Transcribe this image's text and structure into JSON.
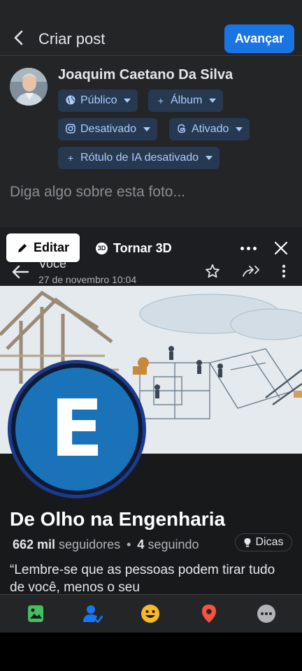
{
  "header": {
    "title": "Criar post",
    "next_label": "Avançar"
  },
  "user": {
    "name": "Joaquim Caetano Da Silva"
  },
  "chips": {
    "audience": "Público",
    "album": "Álbum",
    "instagram": "Desativado",
    "threads": "Ativado",
    "ai_label": "Rótulo de IA desativado"
  },
  "caption": {
    "placeholder": "Diga algo sobre esta foto..."
  },
  "preview": {
    "edit_label": "Editar",
    "to3d_label": "Tornar 3D",
    "to3d_badge": "3D",
    "author": "Você",
    "date": "27 de novembro 10:04",
    "profile_letter": "E",
    "page_name": "De Olho na Engenharia",
    "followers_count": "662 mil",
    "followers_label": "seguidores",
    "separator": "•",
    "following_count": "4",
    "following_label": "seguindo",
    "tips_label": "Dicas",
    "quote": "“Lembre-se que as pessoas podem tirar tudo de você, menos o seu"
  },
  "colors": {
    "accent": "#1b74e4",
    "chip_bg": "#263951",
    "chip_text": "#aecbfa",
    "background": "#242526"
  },
  "toolbar": {
    "items": [
      "photo-icon",
      "tag-people-icon",
      "feeling-icon",
      "location-icon",
      "more-icon"
    ]
  }
}
